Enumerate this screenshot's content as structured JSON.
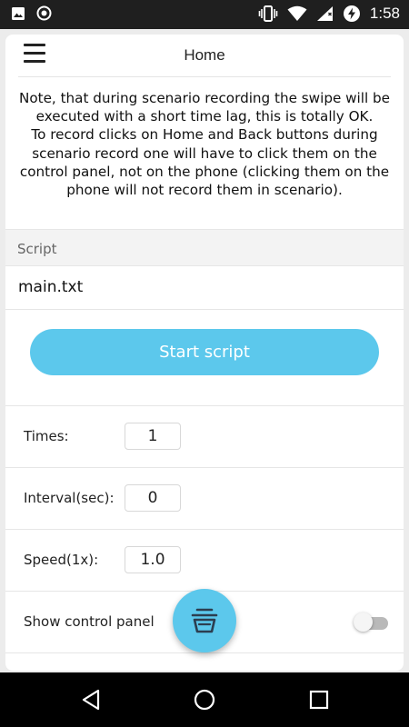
{
  "status_bar": {
    "time": "1:58",
    "icons": [
      "image-icon",
      "record-icon",
      "vibrate-icon",
      "wifi-icon",
      "signal-icon",
      "battery-charging-icon"
    ]
  },
  "header": {
    "title": "Home",
    "menu_icon": "hamburger-menu-icon"
  },
  "note": {
    "paragraph_1": "Note, that during scenario recording the swipe will be executed with a short time lag, this is totally OK.",
    "paragraph_2": "To record clicks on Home and Back buttons during scenario record one will have to click them on the control panel, not on the phone (clicking them on the phone will not record them in scenario)."
  },
  "script": {
    "section_label": "Script",
    "file_name": "main.txt"
  },
  "start_button": {
    "label": "Start script"
  },
  "settings": {
    "times": {
      "label": "Times:",
      "value": "1"
    },
    "interval": {
      "label": "Interval(sec):",
      "value": "0"
    },
    "speed": {
      "label": "Speed(1x):",
      "value": "1.0"
    },
    "control_panel": {
      "label": "Show control panel",
      "enabled": false
    }
  },
  "fab": {
    "icon": "basket-icon"
  },
  "nav_bar": {
    "icons": [
      "back-icon",
      "home-icon",
      "recents-icon"
    ]
  },
  "colors": {
    "accent": "#5cc8ec",
    "status_bar": "#1f1f1f",
    "nav_bar": "#000000"
  }
}
